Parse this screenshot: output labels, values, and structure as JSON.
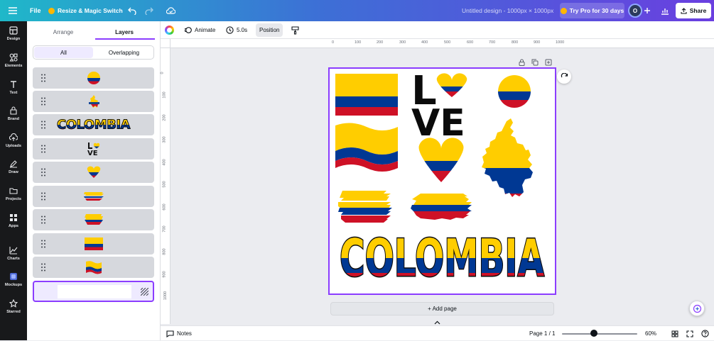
{
  "topbar": {
    "file_label": "File",
    "resize_label": "Resize & Magic Switch",
    "doc_title": "Untitled design - 1000px × 1000px",
    "try_pro_label": "Try Pro for 30 days",
    "avatar_initial": "O",
    "share_label": "Share"
  },
  "rail": [
    {
      "label": "Design",
      "icon": "design-icon"
    },
    {
      "label": "Elements",
      "icon": "elements-icon"
    },
    {
      "label": "Text",
      "icon": "text-icon"
    },
    {
      "label": "Brand",
      "icon": "brand-icon"
    },
    {
      "label": "Uploads",
      "icon": "uploads-icon"
    },
    {
      "label": "Draw",
      "icon": "draw-icon"
    },
    {
      "label": "Projects",
      "icon": "projects-icon"
    },
    {
      "label": "Apps",
      "icon": "apps-icon"
    },
    {
      "label": "Charts",
      "icon": "charts-icon"
    },
    {
      "label": "Mockups",
      "icon": "mockups-icon"
    },
    {
      "label": "Starred",
      "icon": "star-icon"
    }
  ],
  "panel": {
    "tab_arrange": "Arrange",
    "tab_layers": "Layers",
    "seg_all": "All",
    "seg_overlapping": "Overlapping",
    "layers": [
      {
        "name": "flag-circle"
      },
      {
        "name": "map-colombia"
      },
      {
        "name": "text-colombia"
      },
      {
        "name": "text-love"
      },
      {
        "name": "flag-heart"
      },
      {
        "name": "brush-flag-1"
      },
      {
        "name": "brush-flag-2"
      },
      {
        "name": "flag-rect"
      },
      {
        "name": "flag-wave"
      },
      {
        "name": "background"
      }
    ]
  },
  "toolbar": {
    "animate_label": "Animate",
    "duration_label": "5.0s",
    "position_label": "Position"
  },
  "ruler": {
    "top_ticks": [
      "0",
      "100",
      "200",
      "300",
      "400",
      "500",
      "600",
      "700",
      "800",
      "900",
      "1000"
    ],
    "left_ticks": [
      "0",
      "100",
      "200",
      "300",
      "400",
      "500",
      "600",
      "700",
      "800",
      "900",
      "1000"
    ]
  },
  "canvas": {
    "love_l": "L",
    "love_ve": "VE",
    "colombia_text": "COLOMBIA",
    "flag_colors": {
      "yellow": "#ffcd00",
      "blue": "#003893",
      "red": "#ce1126"
    }
  },
  "add_page_label": "+ Add page",
  "bottombar": {
    "notes_label": "Notes",
    "page_label": "Page 1 / 1",
    "zoom_label": "60%",
    "zoom_fraction": 0.42
  },
  "colors": {
    "accent": "#8b3dff",
    "rail_bg": "#18191b"
  }
}
